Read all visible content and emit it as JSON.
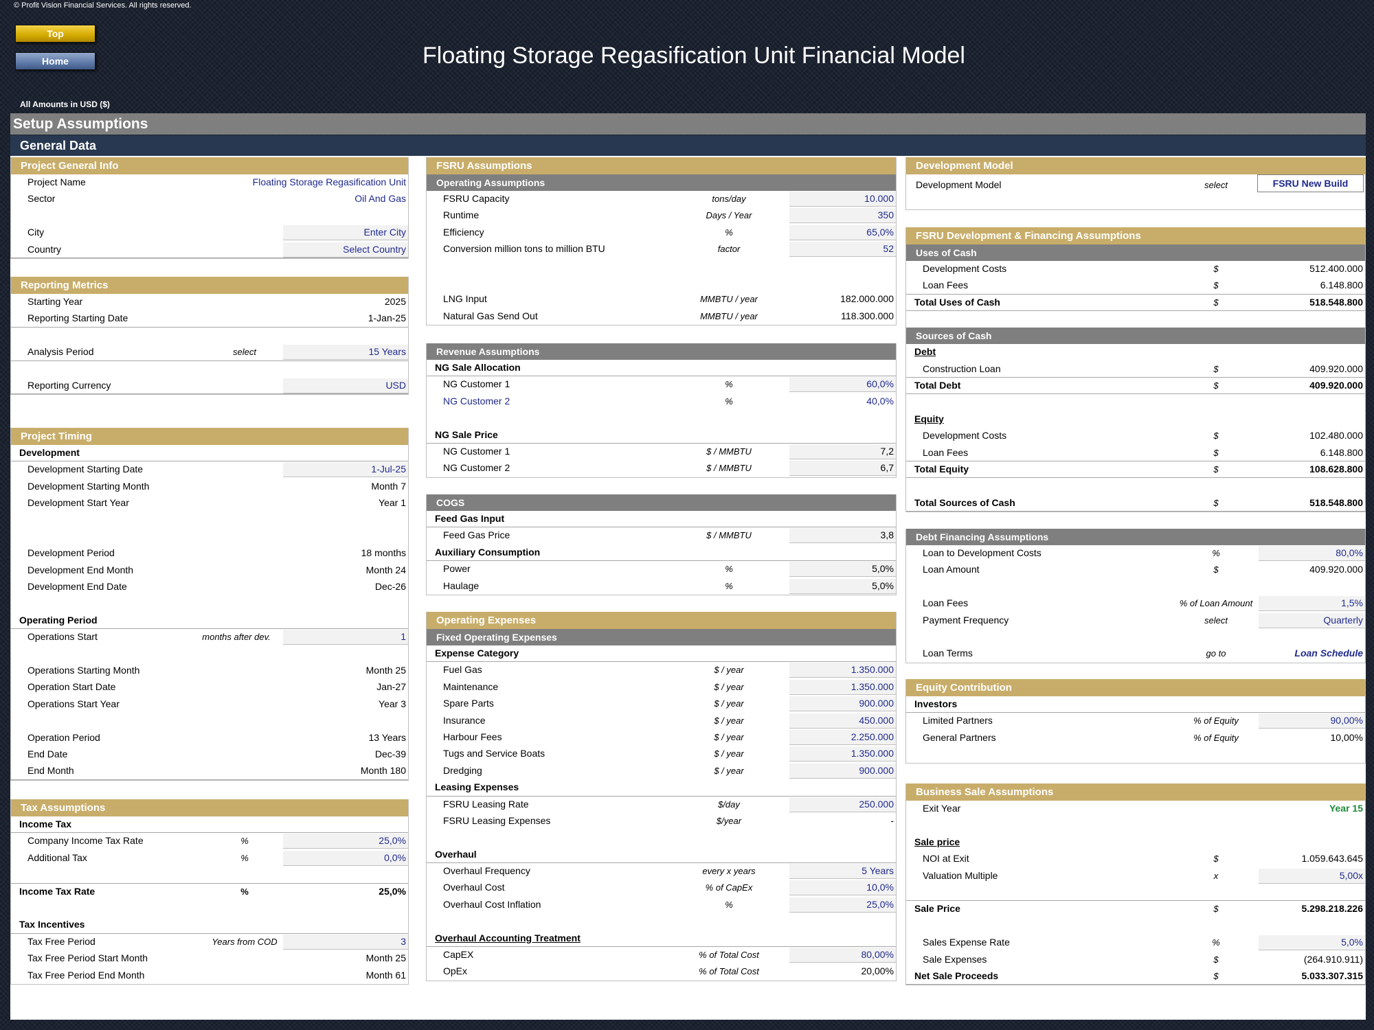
{
  "header": {
    "copyright": "© Profit Vision Financial Services. All rights reserved.",
    "btn_top": "Top",
    "btn_home": "Home",
    "title": "Floating Storage Regasification Unit Financial Model",
    "amounts": "All Amounts in  USD ($)",
    "setup": "Setup Assumptions",
    "general": "General Data"
  },
  "c1": {
    "pgi": {
      "title": "Project General Info",
      "r": [
        [
          "Project Name",
          "",
          "Floating Storage Regasification Unit"
        ],
        [
          "Sector",
          "",
          "Oil And Gas"
        ],
        [
          "",
          "",
          ""
        ],
        [
          "City",
          "",
          "Enter City"
        ],
        [
          "Country",
          "",
          "Select Country"
        ]
      ]
    },
    "rm": {
      "title": "Reporting Metrics",
      "r": [
        [
          "Starting Year",
          "",
          "2025"
        ],
        [
          "Reporting Starting Date",
          "",
          "1-Jan-25"
        ],
        [
          "",
          "",
          ""
        ],
        [
          "Analysis Period",
          "select",
          "15 Years"
        ],
        [
          "",
          "",
          ""
        ],
        [
          "Reporting Currency",
          "",
          "USD"
        ]
      ]
    },
    "pt": {
      "title": "Project Timing",
      "r": [
        [
          "Development",
          "",
          ""
        ],
        [
          "Development Starting Date",
          "",
          "1-Jul-25"
        ],
        [
          "Development Starting Month",
          "",
          "Month 7"
        ],
        [
          "Development Start Year",
          "",
          "Year 1"
        ],
        [
          "",
          "",
          ""
        ],
        [
          "",
          "",
          ""
        ],
        [
          "Development Period",
          "",
          "18 months"
        ],
        [
          "Development End Month",
          "",
          "Month 24"
        ],
        [
          "Development End Date",
          "",
          "Dec-26"
        ],
        [
          "",
          "",
          ""
        ],
        [
          "Operating Period",
          "",
          ""
        ],
        [
          "Operations Start",
          "months after dev.",
          "1"
        ],
        [
          "",
          "",
          ""
        ],
        [
          "Operations Starting Month",
          "",
          "Month 25"
        ],
        [
          "Operation Start Date",
          "",
          "Jan-27"
        ],
        [
          "Operations Start Year",
          "",
          "Year 3"
        ],
        [
          "",
          "",
          ""
        ],
        [
          "Operation Period",
          "",
          "13 Years"
        ],
        [
          "End Date",
          "",
          "Dec-39"
        ],
        [
          "End Month",
          "",
          "Month 180"
        ]
      ]
    },
    "tax": {
      "title": "Tax Assumptions",
      "r": [
        [
          "Income Tax",
          "",
          ""
        ],
        [
          "Company Income Tax Rate",
          "%",
          "25,0%"
        ],
        [
          "Additional Tax",
          "%",
          "0,0%"
        ],
        [
          "",
          "",
          ""
        ],
        [
          "Income Tax Rate",
          "%",
          "25,0%"
        ],
        [
          "",
          "",
          ""
        ],
        [
          "Tax Incentives",
          "",
          ""
        ],
        [
          "Tax Free Period",
          "Years from COD",
          "3"
        ],
        [
          "Tax Free Period Start Month",
          "",
          "Month 25"
        ],
        [
          "Tax Free Period End Month",
          "",
          "Month 61"
        ]
      ]
    }
  },
  "c2": {
    "title": "FSRU Assumptions",
    "op": {
      "title": "Operating Assumptions",
      "r": [
        [
          "FSRU Capacity",
          "tons/day",
          "10.000"
        ],
        [
          "Runtime",
          "Days / Year",
          "350"
        ],
        [
          "Efficiency",
          "%",
          "65,0%"
        ],
        [
          "Conversion million tons to million BTU",
          "factor",
          "52"
        ],
        [
          "",
          "",
          ""
        ],
        [
          "",
          "",
          ""
        ],
        [
          "LNG Input",
          "MMBTU / year",
          "182.000.000"
        ],
        [
          "Natural Gas Send Out",
          "MMBTU / year",
          "118.300.000"
        ]
      ]
    },
    "rev": {
      "title": "Revenue Assumptions",
      "r": [
        [
          "NG Sale Allocation",
          "",
          ""
        ],
        [
          "NG Customer 1",
          "%",
          "60,0%"
        ],
        [
          "NG Customer 2",
          "%",
          "40,0%"
        ],
        [
          "",
          "",
          ""
        ],
        [
          "NG Sale Price",
          "",
          ""
        ],
        [
          "NG Customer 1",
          "$ / MMBTU",
          "7,2"
        ],
        [
          "NG Customer 2",
          "$ / MMBTU",
          "6,7"
        ]
      ]
    },
    "cogs": {
      "title": "COGS",
      "r": [
        [
          "Feed Gas Input",
          "",
          ""
        ],
        [
          "Feed Gas Price",
          "$ / MMBTU",
          "3,8"
        ],
        [
          "Auxiliary Consumption",
          "",
          ""
        ],
        [
          "Power",
          "%",
          "5,0%"
        ],
        [
          "Haulage",
          "%",
          "5,0%"
        ]
      ]
    },
    "opex": {
      "title": "Operating Expenses",
      "sub": "Fixed Operating Expenses",
      "r": [
        [
          "Expense Category",
          "",
          ""
        ],
        [
          "Fuel Gas",
          "$ / year",
          "1.350.000"
        ],
        [
          "Maintenance",
          "$ / year",
          "1.350.000"
        ],
        [
          "Spare Parts",
          "$ / year",
          "900.000"
        ],
        [
          "Insurance",
          "$ / year",
          "450.000"
        ],
        [
          "Harbour Fees",
          "$ / year",
          "2.250.000"
        ],
        [
          "Tugs and Service Boats",
          "$ / year",
          "1.350.000"
        ],
        [
          "Dredging",
          "$ / year",
          "900.000"
        ],
        [
          "Leasing Expenses",
          "",
          ""
        ],
        [
          "FSRU Leasing Rate",
          "$/day",
          "250.000"
        ],
        [
          "FSRU Leasing Expenses",
          "$/year",
          "-"
        ],
        [
          "",
          "",
          ""
        ],
        [
          "Overhaul",
          "",
          ""
        ],
        [
          "Overhaul Frequency",
          "every x years",
          "5 Years"
        ],
        [
          "Overhaul Cost",
          "% of CapEx",
          "10,0%"
        ],
        [
          "Overhaul Cost Inflation",
          "%",
          "25,0%"
        ],
        [
          "",
          "",
          ""
        ],
        [
          "Overhaul Accounting Treatment",
          "",
          ""
        ],
        [
          "CapEX",
          "% of Total Cost",
          "80,00%"
        ],
        [
          "OpEx",
          "% of Total Cost",
          "20,00%"
        ]
      ]
    }
  },
  "c3": {
    "dm": {
      "title": "Development Model",
      "label": "Development Model",
      "unit": "select",
      "value": "FSRU New Build"
    },
    "fin": {
      "title": "FSRU Development & Financing Assumptions",
      "uses": "Uses of Cash",
      "r1": [
        [
          "Development Costs",
          "$",
          "512.400.000"
        ],
        [
          "Loan Fees",
          "$",
          "6.148.800"
        ],
        [
          "Total Uses of Cash",
          "$",
          "518.548.800"
        ]
      ],
      "sources": "Sources of Cash",
      "r2": [
        [
          "Debt",
          "",
          ""
        ],
        [
          "Construction Loan",
          "$",
          "409.920.000"
        ],
        [
          "Total Debt",
          "$",
          "409.920.000"
        ],
        [
          "",
          "",
          ""
        ],
        [
          "Equity",
          "",
          ""
        ],
        [
          "Development Costs",
          "$",
          "102.480.000"
        ],
        [
          "Loan Fees",
          "$",
          "6.148.800"
        ],
        [
          "Total Equity",
          "$",
          "108.628.800"
        ],
        [
          "",
          "",
          ""
        ],
        [
          "Total Sources of Cash",
          "$",
          "518.548.800"
        ]
      ]
    },
    "debt": {
      "title": "Debt Financing Assumptions",
      "r": [
        [
          "Loan to Development Costs",
          "%",
          "80,0%"
        ],
        [
          "Loan Amount",
          "$",
          "409.920.000"
        ],
        [
          "",
          "",
          ""
        ],
        [
          "Loan Fees",
          "% of Loan Amount",
          "1,5%"
        ],
        [
          "Payment Frequency",
          "select",
          "Quarterly"
        ],
        [
          "",
          "",
          ""
        ],
        [
          "Loan Terms",
          "go to",
          "Loan Schedule"
        ]
      ]
    },
    "eq": {
      "title": "Equity Contribution",
      "r": [
        [
          "Investors",
          "",
          ""
        ],
        [
          "Limited Partners",
          "% of Equity",
          "90,00%"
        ],
        [
          "General Partners",
          "% of Equity",
          "10,00%"
        ]
      ]
    },
    "bs": {
      "title": "Business Sale Assumptions",
      "r": [
        [
          "Exit Year",
          "",
          "Year 15"
        ],
        [
          "",
          "",
          ""
        ],
        [
          "Sale price",
          "",
          ""
        ],
        [
          "NOI at Exit",
          "$",
          "1.059.643.645"
        ],
        [
          "Valuation Multiple",
          "x",
          "5,00x"
        ],
        [
          "",
          "",
          ""
        ],
        [
          "Sale Price",
          "$",
          "5.298.218.226"
        ],
        [
          "",
          "",
          ""
        ],
        [
          "Sales Expense Rate",
          "%",
          "5,0%"
        ],
        [
          "Sale Expenses",
          "$",
          "(264.910.911)"
        ],
        [
          "Net Sale Proceeds",
          "$",
          "5.033.307.315"
        ]
      ]
    }
  }
}
